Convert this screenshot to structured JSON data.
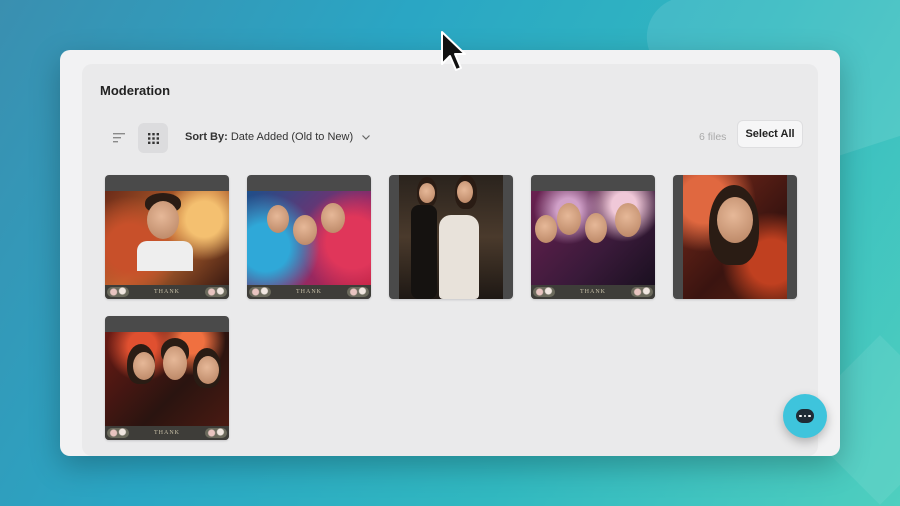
{
  "page": {
    "title": "Moderation"
  },
  "toolbar": {
    "sort_label": "Sort By:",
    "sort_value": "Date Added (Old to New)",
    "files_count": "6 files",
    "select_all": "Select All"
  },
  "strip_text": "THANK",
  "icons": {
    "sort": "sort-lines-icon",
    "grid": "grid-view-icon",
    "chevron": "chevron-down-icon",
    "chat": "chat-bubble-icon",
    "cursor": "mouse-pointer-icon"
  },
  "colors": {
    "chat_button": "#3ec4dc",
    "strip": "#3e3d39"
  }
}
